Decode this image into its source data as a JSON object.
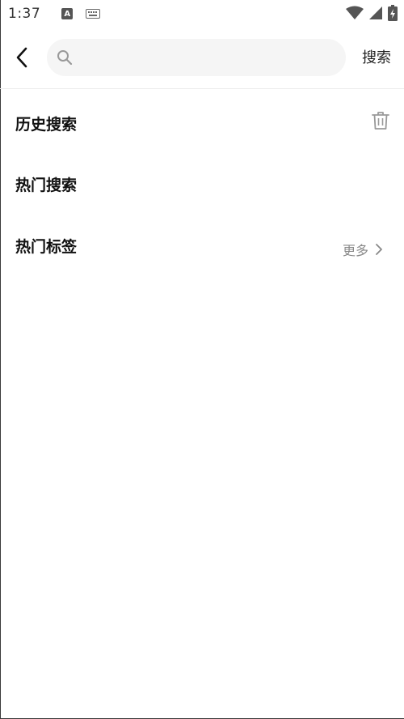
{
  "status_bar": {
    "time": "1:37",
    "notification_icons": [
      "a-icon",
      "keyboard-icon"
    ],
    "system_icons": [
      "wifi-icon",
      "signal-icon",
      "battery-charging-icon"
    ]
  },
  "header": {
    "back_icon": "chevron-left-icon",
    "search": {
      "icon": "search-icon",
      "value": "",
      "placeholder": ""
    },
    "search_button_label": "搜索"
  },
  "sections": {
    "history": {
      "title": "历史搜索",
      "action_icon": "trash-icon"
    },
    "hot_search": {
      "title": "热门搜索"
    },
    "hot_tags": {
      "title": "热门标签",
      "more_label": "更多",
      "more_icon": "chevron-right-icon"
    }
  },
  "colors": {
    "background": "#ffffff",
    "search_box": "#f5f5f5",
    "text_primary": "#111111",
    "text_secondary": "#888888"
  }
}
